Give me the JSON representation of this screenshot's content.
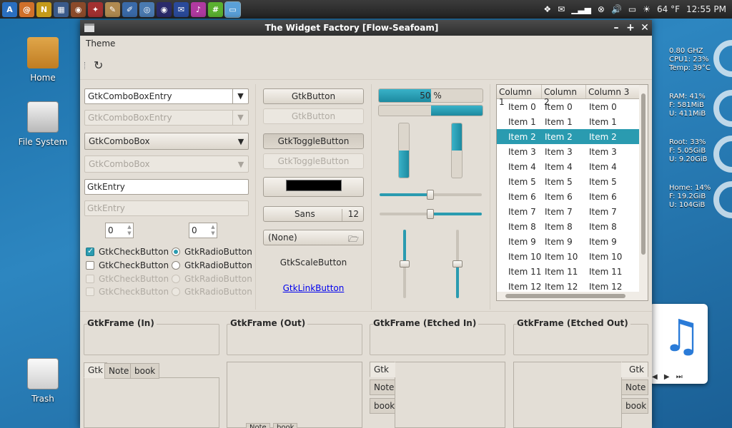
{
  "panel": {
    "launchers": [
      {
        "name": "app-launcher-icon",
        "color": "#2a6fc0",
        "glyph": "A"
      },
      {
        "name": "browser-icon",
        "color": "#d0702a",
        "glyph": "@"
      },
      {
        "name": "notes-app-icon",
        "color": "#c49a1a",
        "glyph": "N"
      },
      {
        "name": "monitor-app-icon",
        "color": "#3a5a8a",
        "glyph": "▦"
      },
      {
        "name": "media-player-icon",
        "color": "#8a4a2a",
        "glyph": "◉"
      },
      {
        "name": "tools-icon",
        "color": "#a23030",
        "glyph": "✦"
      },
      {
        "name": "text-editor-icon",
        "color": "#b08a50",
        "glyph": "✎"
      },
      {
        "name": "drawing-icon",
        "color": "#3a6aa8",
        "glyph": "✐"
      },
      {
        "name": "spiral-app-icon",
        "color": "#4a7ab0",
        "glyph": "◎"
      },
      {
        "name": "eye-app-icon",
        "color": "#2a2a6a",
        "glyph": "◉"
      },
      {
        "name": "chat-icon",
        "color": "#2a4a9a",
        "glyph": "✉"
      },
      {
        "name": "music-app-icon",
        "color": "#b03aa0",
        "glyph": "♪"
      },
      {
        "name": "terminal-icon",
        "color": "#5ab030",
        "glyph": "#"
      },
      {
        "name": "window-list-icon",
        "color": "#4a8ac8",
        "glyph": "▭"
      }
    ],
    "tray": {
      "weather": "64 °F",
      "time": "12:55 PM"
    }
  },
  "desktop": {
    "icons": [
      {
        "label": "Home"
      },
      {
        "label": "File System"
      },
      {
        "label": "Trash"
      }
    ],
    "conky": {
      "cpu": [
        "0.80 GHZ",
        "CPU1: 23%",
        "Temp: 39°C"
      ],
      "ram": [
        "RAM: 41%",
        "F: 581MiB",
        "U: 411MiB"
      ],
      "root": [
        "Root: 33%",
        "F: 5.05GiB",
        "U: 9.20GiB"
      ],
      "home": [
        "Home: 14%",
        "F: 19.2GiB",
        "U: 104GiB"
      ]
    }
  },
  "window": {
    "title": "The Widget Factory [Flow-Seafoam]",
    "menu": {
      "theme": "Theme"
    },
    "col1": {
      "combo_entry": "GtkComboBoxEntry",
      "combo_entry_dis": "GtkComboBoxEntry",
      "combo": "GtkComboBox",
      "combo_dis": "GtkComboBox",
      "entry": "GtkEntry",
      "entry_dis": "GtkEntry",
      "spin1": "0",
      "spin2": "0",
      "check": "GtkCheckButton",
      "radio": "GtkRadioButton"
    },
    "col2": {
      "button": "GtkButton",
      "toggle": "GtkToggleButton",
      "font": "Sans",
      "font_size": "12",
      "file": "(None)",
      "scale": "GtkScaleButton",
      "link": "GtkLinkButton"
    },
    "col3": {
      "progress_label": "50 %",
      "progress": 0.5,
      "progress2_fill": 0.5
    },
    "tree": {
      "columns": [
        "Column 1",
        "Column 2",
        "Column 3"
      ],
      "rows": [
        [
          "Item 0",
          "Item 0",
          "Item 0"
        ],
        [
          "Item 1",
          "Item 1",
          "Item 1"
        ],
        [
          "Item 2",
          "Item 2",
          "Item 2"
        ],
        [
          "Item 3",
          "Item 3",
          "Item 3"
        ],
        [
          "Item 4",
          "Item 4",
          "Item 4"
        ],
        [
          "Item 5",
          "Item 5",
          "Item 5"
        ],
        [
          "Item 6",
          "Item 6",
          "Item 6"
        ],
        [
          "Item 7",
          "Item 7",
          "Item 7"
        ],
        [
          "Item 8",
          "Item 8",
          "Item 8"
        ],
        [
          "Item 9",
          "Item 9",
          "Item 9"
        ],
        [
          "Item 10",
          "Item 10",
          "Item 10"
        ],
        [
          "Item 11",
          "Item 11",
          "Item 11"
        ],
        [
          "Item 12",
          "Item 12",
          "Item 12"
        ]
      ],
      "selected": 2
    },
    "frames": [
      "GtkFrame (In)",
      "GtkFrame (Out)",
      "GtkFrame (Etched In)",
      "GtkFrame (Etched Out)"
    ],
    "tabs": [
      "Gtk",
      "Note",
      "book"
    ],
    "colors": {
      "accent": "#2a9bb0",
      "window": "#e3ded6"
    }
  }
}
